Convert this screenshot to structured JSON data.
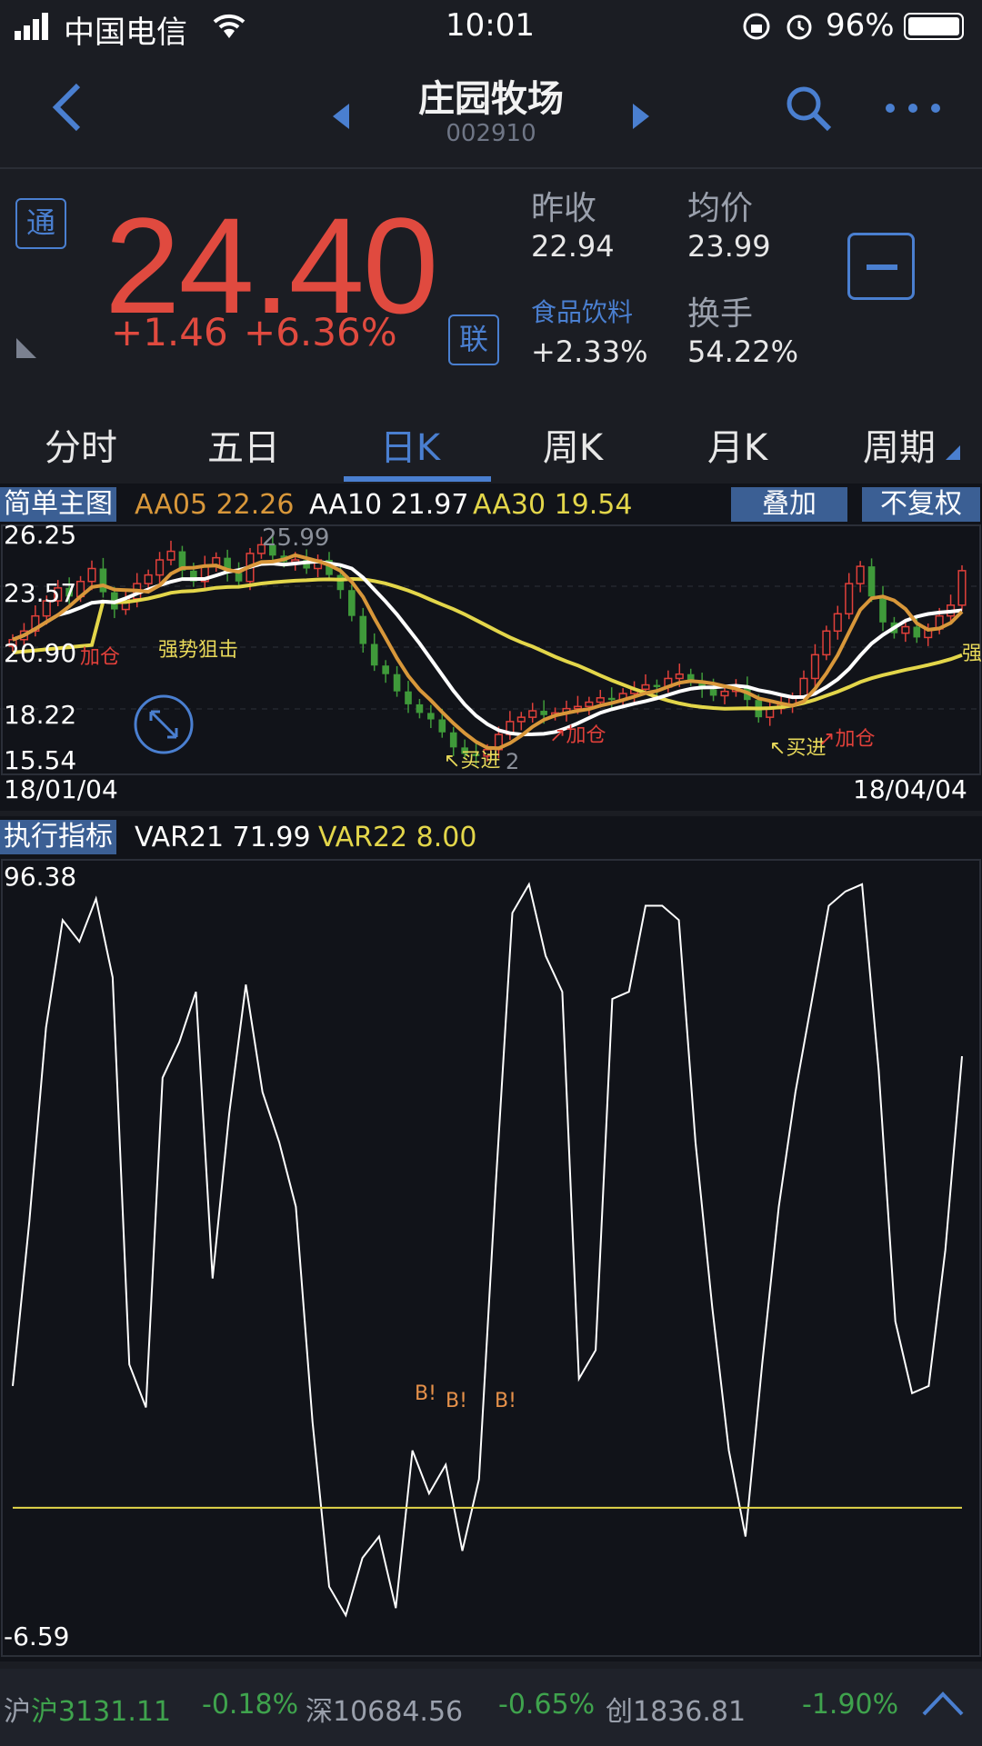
{
  "status_bar": {
    "carrier": "中国电信",
    "time": "10:01",
    "battery": "96%"
  },
  "nav": {
    "title": "庄园牧场",
    "code": "002910",
    "back_icon": "chevron-left-icon",
    "prev_icon": "triangle-left-icon",
    "next_icon": "triangle-right-icon",
    "search_icon": "search-icon",
    "more_icon": "more-icon"
  },
  "quote": {
    "tong_badge": "通",
    "lian_badge": "联",
    "price": "24.40",
    "change": "+1.46",
    "change_pct": "+6.36%",
    "prev_close_label": "昨收",
    "prev_close": "22.94",
    "avg_label": "均价",
    "avg": "23.99",
    "sector_label": "食品饮料",
    "sector_pct": "+2.33%",
    "turnover_label": "换手",
    "turnover": "54.22%"
  },
  "tabs": [
    "分时",
    "五日",
    "日K",
    "周K",
    "月K",
    "周期"
  ],
  "active_tab": 2,
  "kline": {
    "title": "简单主图",
    "ma5": "AA05 22.26",
    "ma10": "AA10 21.97",
    "ma30": "AA30 19.54",
    "overlay_btn": "叠加",
    "adjust_btn": "不复权",
    "y_labels": [
      "26.25",
      "23.57",
      "20.90",
      "18.22",
      "15.54"
    ],
    "high_marker": "25.99",
    "low_marker": "2",
    "date_start": "18/01/04",
    "date_end": "18/04/04",
    "annotations": [
      {
        "text": "加仓",
        "color": "#e0403a"
      },
      {
        "text": "强势狙击",
        "color": "#e8d95a"
      },
      {
        "text": "买进",
        "color": "#e8d95a"
      },
      {
        "text": "加仓",
        "color": "#e0403a"
      },
      {
        "text": "买进",
        "color": "#e8d95a"
      },
      {
        "text": "加仓",
        "color": "#e0403a"
      },
      {
        "text": "强",
        "color": "#e8d95a"
      }
    ],
    "colors": {
      "up": "#e0403a",
      "down": "#3f9a3a",
      "ma5": "#d8973a",
      "ma10": "#ffffff",
      "ma30": "#e3d64a"
    }
  },
  "indicator": {
    "title": "执行指标",
    "var21": "VAR21 71.99",
    "var22": "VAR22 8.00",
    "y_max": "96.38",
    "y_min": "-6.59",
    "signals": [
      "B!",
      "B!",
      "B!"
    ]
  },
  "chart_data": {
    "type": "line",
    "title": "",
    "series": [
      {
        "name": "VAR21",
        "values": [
          25,
          48,
          75,
          90,
          87,
          93,
          82,
          28,
          22,
          68,
          73,
          80,
          40,
          63,
          81,
          66,
          59,
          50,
          20,
          -3,
          -7,
          1,
          4,
          -6,
          16,
          10,
          14,
          2,
          12,
          53,
          91,
          95,
          85,
          80,
          26,
          30,
          79,
          80,
          92,
          92,
          90,
          59,
          36,
          16,
          4,
          28,
          50,
          66,
          79,
          92,
          94,
          95,
          69,
          34,
          24,
          25,
          44,
          71
        ]
      },
      {
        "name": "VAR22",
        "values": [
          8,
          8,
          8,
          8,
          8,
          8,
          8,
          8,
          8,
          8,
          8,
          8,
          8,
          8,
          8,
          8,
          8,
          8,
          8,
          8,
          8,
          8,
          8,
          8,
          8,
          8,
          8,
          8,
          8,
          8,
          8,
          8,
          8,
          8,
          8,
          8,
          8,
          8,
          8,
          8,
          8,
          8,
          8,
          8,
          8,
          8,
          8,
          8,
          8,
          8,
          8,
          8,
          8,
          8,
          8,
          8,
          8,
          8
        ]
      }
    ],
    "ylim": [
      -6.59,
      96.38
    ],
    "grid": false
  },
  "footer": {
    "sh": "沪3131.11",
    "sh_pct": "-0.18%",
    "sz": "深10684.56",
    "sz_pct": "-0.65%",
    "cy": "创1836.81",
    "cy_pct": "-1.90%"
  }
}
